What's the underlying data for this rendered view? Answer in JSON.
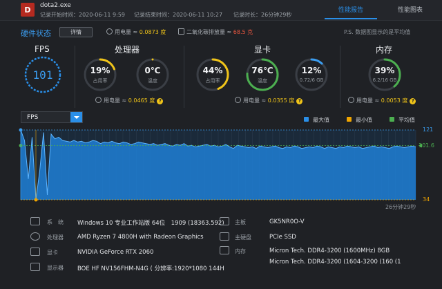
{
  "header": {
    "app_badge": "D",
    "app_title": "dota2.exe",
    "record_start": "记录开始时间：2020-06-11 9:59",
    "record_end": "记录结束时间：2020-06-11 10:27",
    "record_duration": "记录时长：26分钟29秒",
    "tabs": [
      {
        "label": "性能报告",
        "active": true
      },
      {
        "label": "性能图表",
        "active": false
      }
    ]
  },
  "hardware": {
    "section_title": "硬件状态",
    "detail_button": "详情",
    "power_label": "用电量 ≈ ",
    "power_value": "0.0873 度",
    "co2_label": "二氧化碳排放量 ≈ ",
    "co2_value": "68.5 克",
    "ps_note": "P.S. 数据图显示的是平均值"
  },
  "gauges": {
    "fps": {
      "label": "FPS",
      "value": "101"
    },
    "cpu": {
      "title": "处理器",
      "usage": {
        "value": "19%",
        "sub": "占用率",
        "fraction": 0.19,
        "color": "#f0c419"
      },
      "temp": {
        "value": "0℃",
        "sub": "温度",
        "fraction": 0.0,
        "color": "#f0c419"
      },
      "power_label": "用电量 ≈ ",
      "power_value": "0.0465 度"
    },
    "gpu": {
      "title": "显卡",
      "usage": {
        "value": "44%",
        "sub": "占用率",
        "fraction": 0.44,
        "color": "#f0c419"
      },
      "temp": {
        "value": "76℃",
        "sub": "温度",
        "fraction": 0.76,
        "color": "#4caf50"
      },
      "mem": {
        "value": "12%",
        "sub": "0.72/6 GB",
        "fraction": 0.12,
        "color": "#3b9df0"
      },
      "power_label": "用电量 ≈ ",
      "power_value": "0.0355 度"
    },
    "ram": {
      "title": "内存",
      "usage": {
        "value": "39%",
        "sub": "6.2/16 GB",
        "fraction": 0.39,
        "color": "#4caf50"
      },
      "power_label": "用电量 ≈ ",
      "power_value": "0.0053 度"
    }
  },
  "chart_controls": {
    "selected_metric": "FPS",
    "legend": [
      {
        "label": "最大值",
        "color": "#2a8fe8"
      },
      {
        "label": "最小值",
        "color": "#f0a500"
      },
      {
        "label": "平均值",
        "color": "#4caf50"
      }
    ],
    "duration": "26分钟29秒"
  },
  "chart_data": {
    "type": "area",
    "max_label": "121",
    "avg_label": "101.6",
    "min_label": "34",
    "max": 121,
    "avg": 101.6,
    "min": 34,
    "ylim": [
      34,
      121
    ],
    "values": [
      121,
      108,
      60,
      112,
      34,
      70,
      118,
      40,
      116,
      110,
      112,
      108,
      107,
      106,
      108,
      106,
      107,
      105,
      106,
      108,
      107,
      104,
      106,
      105,
      107,
      105,
      104,
      106,
      105,
      103,
      104,
      106,
      105,
      104,
      103,
      104,
      102,
      103,
      104,
      102,
      101,
      103,
      102,
      104,
      101,
      102,
      100,
      101,
      102,
      103,
      101,
      102,
      100,
      101,
      103,
      100,
      98,
      102,
      101,
      100,
      99,
      100,
      98,
      101,
      100,
      99,
      100,
      101,
      99,
      98,
      100,
      99,
      101,
      100,
      98,
      99,
      100,
      99,
      101,
      100,
      98,
      100,
      99,
      98,
      100,
      99,
      101,
      100,
      99,
      100,
      98,
      99,
      100,
      101,
      99,
      100,
      99,
      98,
      100,
      101,
      100,
      99,
      100,
      101,
      100
    ]
  },
  "specs": [
    {
      "key": "系　统",
      "value": "Windows 10 专业工作站版 64位　1909 (18363.592)",
      "icon": "windows-icon"
    },
    {
      "key": "处理器",
      "value": "AMD Ryzen 7 4800H with Radeon Graphics",
      "icon": "cpu-icon"
    },
    {
      "key": "显卡",
      "value": "NVIDIA GeForce RTX 2060",
      "icon": "gpu-icon"
    },
    {
      "key": "显示器",
      "value": "BOE HF NV156FHM-N4G ( 分辨率:1920*1080 144H",
      "icon": "monitor-icon"
    },
    {
      "key": "主板",
      "value": "GK5NR0O-V",
      "icon": "motherboard-icon"
    },
    {
      "key": "主硬盘",
      "value": "PCIe SSD",
      "icon": "disk-icon"
    },
    {
      "key": "内存",
      "value": "Micron Tech. DDR4-3200 (1600MHz) 8GB",
      "icon": "memory-icon"
    },
    {
      "key": "",
      "value": "Micron Tech. DDR4-3200 (1604-3200 (160 (1",
      "icon": ""
    }
  ]
}
